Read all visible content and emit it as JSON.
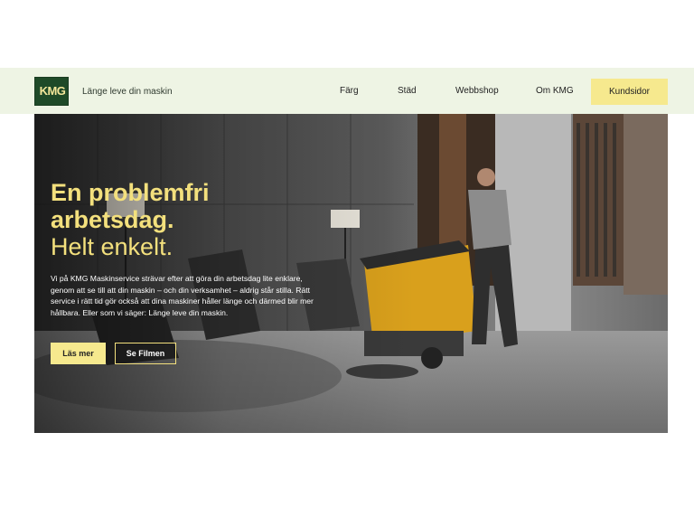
{
  "brand": {
    "logo_text": "KMG",
    "tagline": "Länge leve din maskin"
  },
  "nav": {
    "items": [
      "Färg",
      "Städ",
      "Webbshop",
      "Om KMG"
    ],
    "cta_label": "Kundsidor"
  },
  "hero": {
    "title_lines": [
      "En problemfri",
      "arbetsdag."
    ],
    "subtitle": "Helt enkelt.",
    "body": "Vi på KMG Maskinservice strävar efter att göra din arbetsdag lite enklare, genom att se till att din maskin – och din verksamhet – aldrig står stilla. Rätt service i rätt tid gör också att dina maskiner håller länge och därmed blir mer hållbara. Eller som vi säger: Länge leve din maskin.",
    "primary_button": "Läs mer",
    "secondary_button": "Se Filmen",
    "image_alt": "hero-photo"
  },
  "colors": {
    "header_bg": "#eef4e4",
    "accent_yellow": "#f6e98e",
    "logo_green": "#1f4a28",
    "title_yellow": "#f3e07d"
  }
}
